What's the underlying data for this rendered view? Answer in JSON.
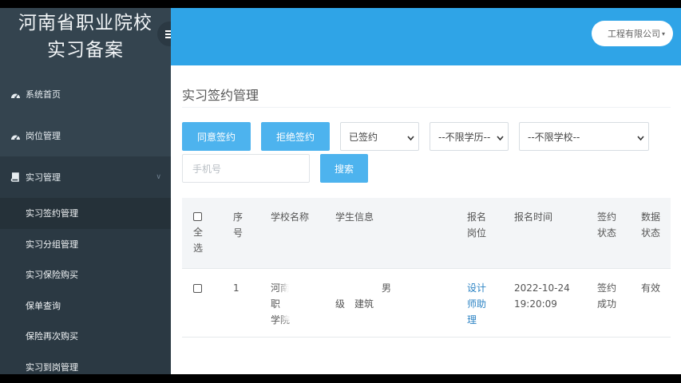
{
  "app": {
    "title_line1": "河南省职业院校",
    "title_line2": "实习备案"
  },
  "sidebar": {
    "items": [
      {
        "label": "系统首页",
        "icon": "dashboard-icon"
      },
      {
        "label": "岗位管理",
        "icon": "dashboard-icon"
      },
      {
        "label": "实习管理",
        "icon": "book-icon"
      }
    ],
    "submenu": [
      {
        "label": "实习签约管理"
      },
      {
        "label": "实习分组管理"
      },
      {
        "label": "实习保险购买"
      },
      {
        "label": "保单查询"
      },
      {
        "label": "保险再次购买"
      },
      {
        "label": "实习到岗管理"
      }
    ]
  },
  "header": {
    "user_label": "工程有限公司"
  },
  "page": {
    "title": "实习签约管理",
    "agree_button": "同意签约",
    "reject_button": "拒绝签约",
    "sign_status_select": "已签约",
    "education_select": "--不限学历--",
    "school_select": "--不限学校--",
    "phone_placeholder": "手机号",
    "search_button": "搜索"
  },
  "table": {
    "headers": {
      "select_all": [
        "全",
        "选"
      ],
      "index": [
        "序",
        "号"
      ],
      "school": "学校名称",
      "student": "学生信息",
      "post": [
        "报名",
        "岗位"
      ],
      "time": "报名时间",
      "sign_status": [
        "签约",
        "状态"
      ],
      "data_status": [
        "数据",
        "状态"
      ]
    },
    "rows": [
      {
        "index": "1",
        "school": [
          "河南",
          "职",
          "学院"
        ],
        "student": [
          "男",
          "级",
          "建筑"
        ],
        "post": [
          "设计",
          "师助",
          "理"
        ],
        "time": [
          "2022-10-24",
          "19:20:09"
        ],
        "sign_status": [
          "签约",
          "成功"
        ],
        "data_status": "有效"
      }
    ]
  },
  "colors": {
    "sidebar": "#34444f",
    "topbar": "#2fa4e7",
    "button": "#4db3ee",
    "link": "#2b83c4"
  }
}
